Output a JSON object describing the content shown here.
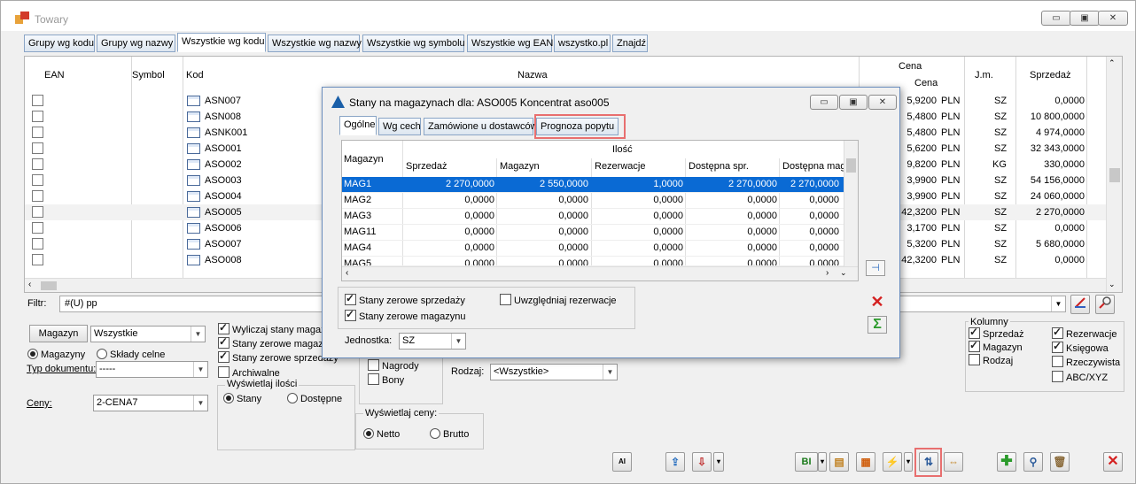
{
  "window": {
    "title": "Towary",
    "min_label": "▭",
    "max_label": "▣",
    "close_label": "✕"
  },
  "tabs": [
    "Grupy wg kodu",
    "Grupy wg nazwy",
    "Wszystkie wg kodu",
    "Wszystkie wg nazwy",
    "Wszystkie wg symbolu",
    "Wszystkie wg EAN",
    "wszystko.pl",
    "Znajdź"
  ],
  "grid": {
    "headers": {
      "ean": "EAN",
      "symbol": "Symbol",
      "kod": "Kod",
      "nazwa": "Nazwa",
      "cena_group": "Cena",
      "cena": "Cena",
      "jm": "J.m.",
      "sprzedaz": "Sprzedaż"
    },
    "rows": [
      {
        "kod": "ASN007",
        "cena": "5,9200",
        "waluta": "PLN",
        "jm": "SZ",
        "sprzedaz": "0,0000"
      },
      {
        "kod": "ASN008",
        "cena": "5,4800",
        "waluta": "PLN",
        "jm": "SZ",
        "sprzedaz": "10 800,0000"
      },
      {
        "kod": "ASNK001",
        "cena": "5,4800",
        "waluta": "PLN",
        "jm": "SZ",
        "sprzedaz": "4 974,0000"
      },
      {
        "kod": "ASO001",
        "cena": "5,6200",
        "waluta": "PLN",
        "jm": "SZ",
        "sprzedaz": "32 343,0000"
      },
      {
        "kod": "ASO002",
        "cena": "9,8200",
        "waluta": "PLN",
        "jm": "KG",
        "sprzedaz": "330,0000"
      },
      {
        "kod": "ASO003",
        "cena": "3,9900",
        "waluta": "PLN",
        "jm": "SZ",
        "sprzedaz": "54 156,0000"
      },
      {
        "kod": "ASO004",
        "cena": "3,9900",
        "waluta": "PLN",
        "jm": "SZ",
        "sprzedaz": "24 060,0000"
      },
      {
        "kod": "ASO005",
        "cena": "42,3200",
        "waluta": "PLN",
        "jm": "SZ",
        "sprzedaz": "2 270,0000"
      },
      {
        "kod": "ASO006",
        "cena": "3,1700",
        "waluta": "PLN",
        "jm": "SZ",
        "sprzedaz": "0,0000"
      },
      {
        "kod": "ASO007",
        "cena": "5,3200",
        "waluta": "PLN",
        "jm": "SZ",
        "sprzedaz": "5 680,0000"
      },
      {
        "kod": "ASO008",
        "cena": "42,3200",
        "waluta": "PLN",
        "jm": "SZ",
        "sprzedaz": "0,0000"
      }
    ]
  },
  "filter": {
    "label": "Filtr:",
    "value": "#(U) pp"
  },
  "bottom": {
    "magazyn_button": "Magazyn",
    "magazyn_value": "Wszystkie",
    "radio_magazyny": "Magazyny",
    "radio_sklady": "Składy celne",
    "typ_dok_label": "Typ dokumentu:",
    "typ_dok_value": "-----",
    "ceny_label": "Ceny:",
    "ceny_value": "2-CENA7",
    "chk_wylicz": "Wyliczaj stany magaz",
    "chk_zerowe_mag": "Stany zerowe magazy",
    "chk_zerowe_sprz": "Stany zerowe sprzedaży",
    "chk_archiwalne": "Archiwalne",
    "wysw_ilosci_title": "Wyświetlaj ilości",
    "radio_stany": "Stany",
    "radio_dostepne": "Dostępne",
    "chk_nagrody": "Nagrody",
    "chk_bony": "Bony",
    "rodzaj_label": "Rodzaj:",
    "rodzaj_value": "<Wszystkie>",
    "wysw_ceny_title": "Wyświetlaj ceny:",
    "radio_netto": "Netto",
    "radio_brutto": "Brutto",
    "kolumny_title": "Kolumny",
    "kol_sprzedaz": "Sprzedaż",
    "kol_magazyn": "Magazyn",
    "kol_rodzaj": "Rodzaj",
    "kol_rezerwacje": "Rezerwacje",
    "kol_ksiegowa": "Księgowa",
    "kol_rzeczywista": "Rzeczywista",
    "kol_abc": "ABC/XYZ"
  },
  "dialog": {
    "title": "Stany na magazynach dla: ASO005 Koncentrat aso005",
    "tabs": [
      "Ogólne",
      "Wg cech",
      "Zamówione u dostawców",
      "Prognoza popytu"
    ],
    "group_header": "Ilość",
    "headers": {
      "magazyn": "Magazyn",
      "sprzedaz": "Sprzedaż",
      "mag": "Magazyn",
      "rezerwacje": "Rezerwacje",
      "dostepna_spr": "Dostępna spr.",
      "dostepna_mag": "Dostępna mag"
    },
    "rows": [
      {
        "mag": "MAG1",
        "sprzedaz": "2 270,0000",
        "magazyn": "2 550,0000",
        "rezerwacje": "1,0000",
        "dost_spr": "2 270,0000",
        "dost_mag": "2 270,0000"
      },
      {
        "mag": "MAG2",
        "sprzedaz": "0,0000",
        "magazyn": "0,0000",
        "rezerwacje": "0,0000",
        "dost_spr": "0,0000",
        "dost_mag": "0,0000"
      },
      {
        "mag": "MAG3",
        "sprzedaz": "0,0000",
        "magazyn": "0,0000",
        "rezerwacje": "0,0000",
        "dost_spr": "0,0000",
        "dost_mag": "0,0000"
      },
      {
        "mag": "MAG11",
        "sprzedaz": "0,0000",
        "magazyn": "0,0000",
        "rezerwacje": "0,0000",
        "dost_spr": "0,0000",
        "dost_mag": "0,0000"
      },
      {
        "mag": "MAG4",
        "sprzedaz": "0,0000",
        "magazyn": "0,0000",
        "rezerwacje": "0,0000",
        "dost_spr": "0,0000",
        "dost_mag": "0,0000"
      },
      {
        "mag": "MAG5",
        "sprzedaz": "0,0000",
        "magazyn": "0,0000",
        "rezerwacje": "0,0000",
        "dost_spr": "0,0000",
        "dost_mag": "0,0000"
      }
    ],
    "chk_zerowe_sprz": "Stany zerowe sprzedaży",
    "chk_zerowe_mag": "Stany zerowe magazynu",
    "chk_rezerwacje": "Uwzględniaj rezerwacje",
    "jednostka_label": "Jednostka:",
    "jednostka_value": "SZ"
  },
  "colors": {
    "accent": "#0a6ad4",
    "highlight": "#e86f6f",
    "close_red": "#d42020",
    "green": "#2a9a2a"
  }
}
